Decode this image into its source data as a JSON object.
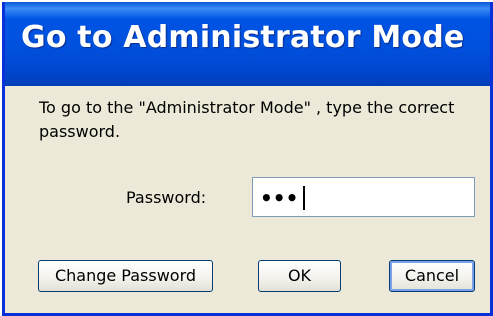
{
  "dialog": {
    "title": "Go to Administrator Mode",
    "message": "To go to the \"Administrator Mode\" , type the correct password.",
    "password_label": "Password:",
    "password_mask": "•••"
  },
  "buttons": {
    "change_password": "Change Password",
    "ok": "OK",
    "cancel": "Cancel"
  },
  "colors": {
    "titlebar": "#0054e3",
    "window_border": "#0831d9",
    "dialog_background": "#ece9d8",
    "button_border": "#003c74",
    "focus_ring": "#7ba2e7"
  }
}
